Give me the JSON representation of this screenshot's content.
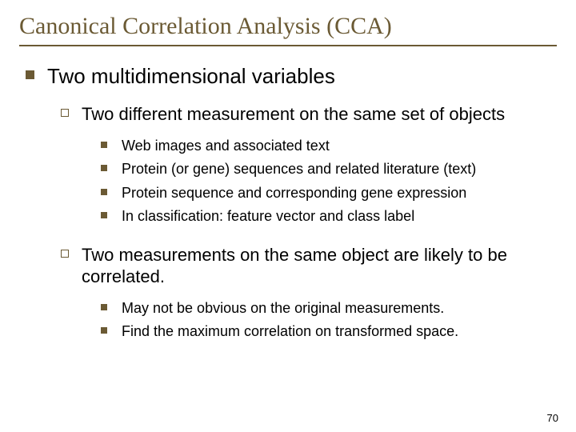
{
  "title": "Canonical Correlation Analysis (CCA)",
  "lvl1": {
    "text": "Two multidimensional variables"
  },
  "lvl2a": {
    "text": "Two different measurement on the same set of objects"
  },
  "lvl3a": [
    "Web images and associated text",
    "Protein (or gene) sequences and related literature (text)",
    "Protein sequence and corresponding gene expression",
    "In classification: feature vector and class label"
  ],
  "lvl2b": {
    "text": "Two measurements on the same object are likely to be correlated."
  },
  "lvl3b": [
    "May not be obvious on the original measurements.",
    "Find the maximum correlation on transformed space."
  ],
  "page": "70"
}
